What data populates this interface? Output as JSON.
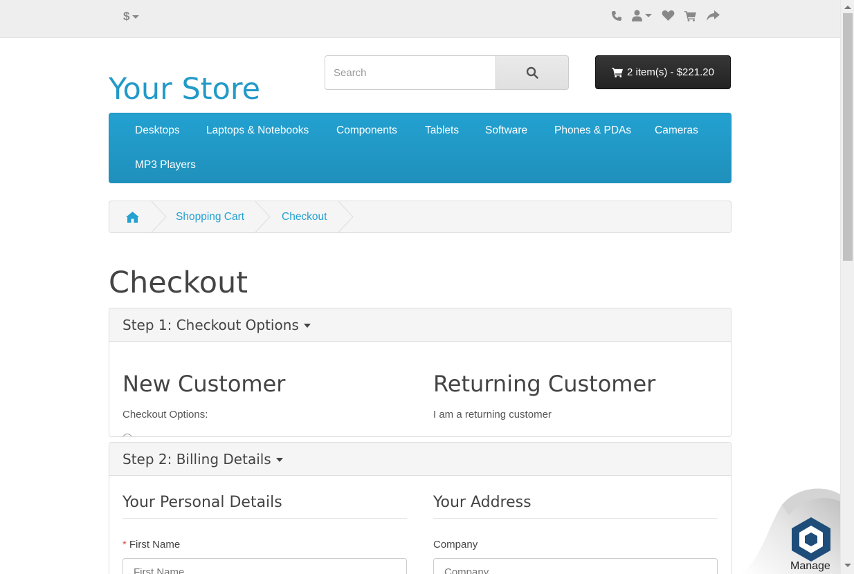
{
  "top_bar": {
    "currency_symbol": "$",
    "icons": [
      "phone-icon",
      "user-icon",
      "heart-icon",
      "cart-icon",
      "share-icon"
    ]
  },
  "header": {
    "logo": "Your Store",
    "search_placeholder": "Search",
    "cart_label": "2 item(s) - $221.20"
  },
  "menu": {
    "items": [
      "Desktops",
      "Laptops & Notebooks",
      "Components",
      "Tablets",
      "Software",
      "Phones & PDAs",
      "Cameras",
      "MP3 Players"
    ]
  },
  "breadcrumb": {
    "items": [
      "Shopping Cart",
      "Checkout"
    ]
  },
  "page_title": "Checkout",
  "step1": {
    "heading": "Step 1: Checkout Options",
    "new_customer_title": "New Customer",
    "new_customer_text": "Checkout Options:",
    "returning_title": "Returning Customer",
    "returning_text": "I am a returning customer"
  },
  "step2": {
    "heading": "Step 2: Billing Details",
    "personal_title": "Your Personal Details",
    "address_title": "Your Address",
    "first_name_label": "First Name",
    "first_name_placeholder": "First Name",
    "company_label": "Company",
    "company_placeholder": "Company"
  },
  "widget": {
    "manage_label": "Manage"
  },
  "colors": {
    "accent": "#229ac8",
    "menu_bg": "#229ac8",
    "cart_bg": "#2a2a2a",
    "required": "#d9534f"
  }
}
